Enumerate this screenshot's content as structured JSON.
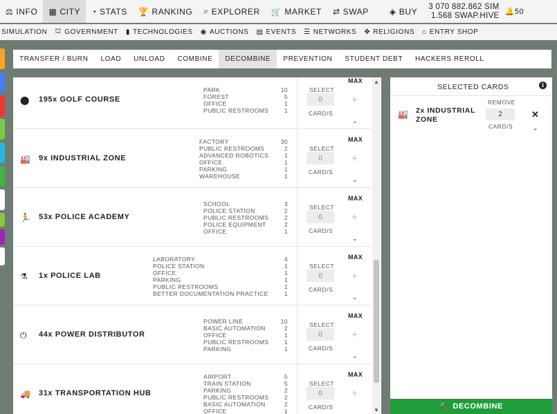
{
  "topnav": {
    "items": [
      {
        "icon": "⚖",
        "label": "INFO",
        "active": false
      },
      {
        "icon": "▦",
        "label": "CITY",
        "active": true
      },
      {
        "icon": "◔",
        "label": "STATS",
        "active": false
      },
      {
        "icon": "🏆",
        "label": "RANKING",
        "active": false
      },
      {
        "icon": "⌕",
        "label": "EXPLORER",
        "active": false
      },
      {
        "icon": "🛒",
        "label": "MARKET",
        "active": false
      },
      {
        "icon": "⇄",
        "label": "SWAP",
        "active": false
      }
    ],
    "buy": {
      "icon": "◈",
      "label": "BUY"
    },
    "balance_sim": "3 070 882.862 SIM",
    "balance_swap": "1.568 SWAP.HIVE",
    "bell_icon": "🔔",
    "notifications": "50"
  },
  "subnav": {
    "items": [
      {
        "icon": "",
        "label": "SIMULATION"
      },
      {
        "icon": "⛫",
        "label": "GOVERNMENT"
      },
      {
        "icon": "▮",
        "label": "TECHNOLOGIES"
      },
      {
        "icon": "◉",
        "label": "AUCTIONS"
      },
      {
        "icon": "▤",
        "label": "EVENTS"
      },
      {
        "icon": "☰",
        "label": "NETWORKS"
      },
      {
        "icon": "✥",
        "label": "RELIGIONS"
      },
      {
        "icon": "⌂",
        "label": "ENTRY SHOP"
      }
    ]
  },
  "sidebar_colors": [
    "#f5a623",
    "#4a7cf0",
    "#e53935",
    "#7cc84a",
    "#29b6d6",
    "#43b04a",
    "#ffffff",
    "#8bc34a",
    "#9c27b0",
    "#ffffff"
  ],
  "tabs": [
    {
      "label": "TRANSFER / BURN",
      "active": false
    },
    {
      "label": "LOAD",
      "active": false
    },
    {
      "label": "UNLOAD",
      "active": false
    },
    {
      "label": "COMBINE",
      "active": false
    },
    {
      "label": "DECOMBINE",
      "active": true
    },
    {
      "label": "PREVENTION",
      "active": false
    },
    {
      "label": "STUDENT DEBT",
      "active": false
    },
    {
      "label": "HACKERS REROLL",
      "active": false
    }
  ],
  "ctrl_labels": {
    "max": "MAX",
    "select": "SELECT",
    "cards": "CARD/S",
    "plus": "+",
    "chevron": "⌄",
    "qty": "0"
  },
  "rows": [
    {
      "icon": "⬤",
      "name": "195x GOLF COURSE",
      "reqs": [
        [
          "PARK",
          "10"
        ],
        [
          "FOREST",
          "5"
        ],
        [
          "OFFICE",
          "1"
        ],
        [
          "PUBLIC RESTROOMS",
          "1"
        ]
      ]
    },
    {
      "icon": "🏭",
      "name": "9x INDUSTRIAL ZONE",
      "reqs": [
        [
          "FACTORY",
          "30"
        ],
        [
          "PUBLIC RESTROOMS",
          "2"
        ],
        [
          "ADVANCED ROBOTICS",
          "1"
        ],
        [
          "OFFICE",
          "1"
        ],
        [
          "PARKING",
          "1"
        ],
        [
          "WAREHOUSE",
          "1"
        ]
      ]
    },
    {
      "icon": "🏃",
      "name": "53x POLICE ACADEMY",
      "reqs": [
        [
          "SCHOOL",
          "3"
        ],
        [
          "POLICE STATION",
          "2"
        ],
        [
          "PUBLIC RESTROOMS",
          "2"
        ],
        [
          "POLICE EQUIPMENT",
          "2"
        ],
        [
          "OFFICE",
          "1"
        ]
      ]
    },
    {
      "icon": "⚗",
      "name": "1x POLICE LAB",
      "reqs": [
        [
          "LABORATORY",
          "4"
        ],
        [
          "POLICE STATION",
          "1"
        ],
        [
          "OFFICE",
          "1"
        ],
        [
          "PARKING",
          "1"
        ],
        [
          "PUBLIC RESTROOMS",
          "1"
        ],
        [
          "BETTER DOCUMENTATION PRACTICE",
          "1"
        ]
      ]
    },
    {
      "icon": "⏻",
      "name": "44x POWER DISTRIBUTOR",
      "reqs": [
        [
          "POWER LINE",
          "10"
        ],
        [
          "BASIC AUTOMATION",
          "2"
        ],
        [
          "OFFICE",
          "1"
        ],
        [
          "PUBLIC RESTROOMS",
          "1"
        ],
        [
          "PARKING",
          "1"
        ]
      ]
    },
    {
      "icon": "🚚",
      "name": "31x TRANSPORTATION HUB",
      "reqs": [
        [
          "AIRPORT",
          "5"
        ],
        [
          "TRAIN STATION",
          "5"
        ],
        [
          "PARKING",
          "2"
        ],
        [
          "PUBLIC RESTROOMS",
          "2"
        ],
        [
          "BASIC AUTOMATION",
          "2"
        ],
        [
          "OFFICE",
          "1"
        ]
      ]
    }
  ],
  "scroll_arrows": {
    "up": "▲",
    "down": "▼"
  },
  "selected": {
    "title": "SELECTED CARDS",
    "info_icon": "i",
    "item": {
      "icon": "🏭",
      "name": "2x INDUSTRIAL ZONE",
      "remove_label": "REMOVE",
      "qty": "2",
      "cards_label": "CARD/S",
      "close": "✕",
      "chevron": "⌄"
    }
  },
  "decombine": {
    "icon": "🔨",
    "label": "DECOMBINE"
  }
}
